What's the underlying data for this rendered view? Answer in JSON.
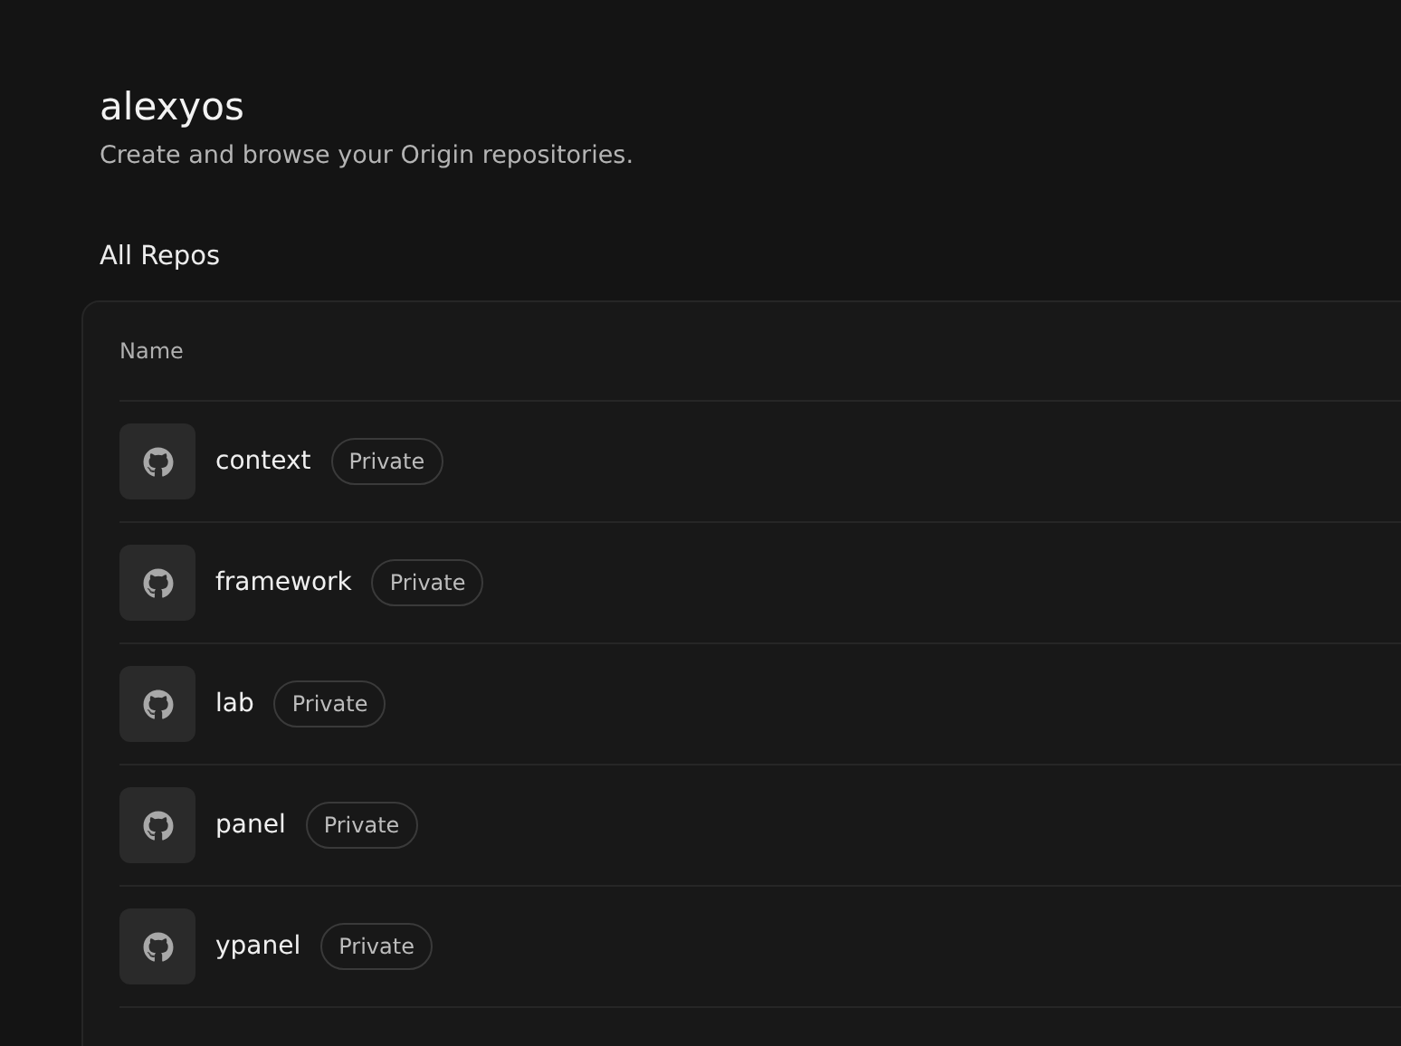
{
  "header": {
    "title": "alexyos",
    "subtitle": "Create and browse your Origin repositories."
  },
  "section_title": "All Repos",
  "table": {
    "columns": [
      "Name"
    ],
    "rows": [
      {
        "name": "context",
        "badge": "Private"
      },
      {
        "name": "framework",
        "badge": "Private"
      },
      {
        "name": "lab",
        "badge": "Private"
      },
      {
        "name": "panel",
        "badge": "Private"
      },
      {
        "name": "ypanel",
        "badge": "Private"
      }
    ]
  }
}
